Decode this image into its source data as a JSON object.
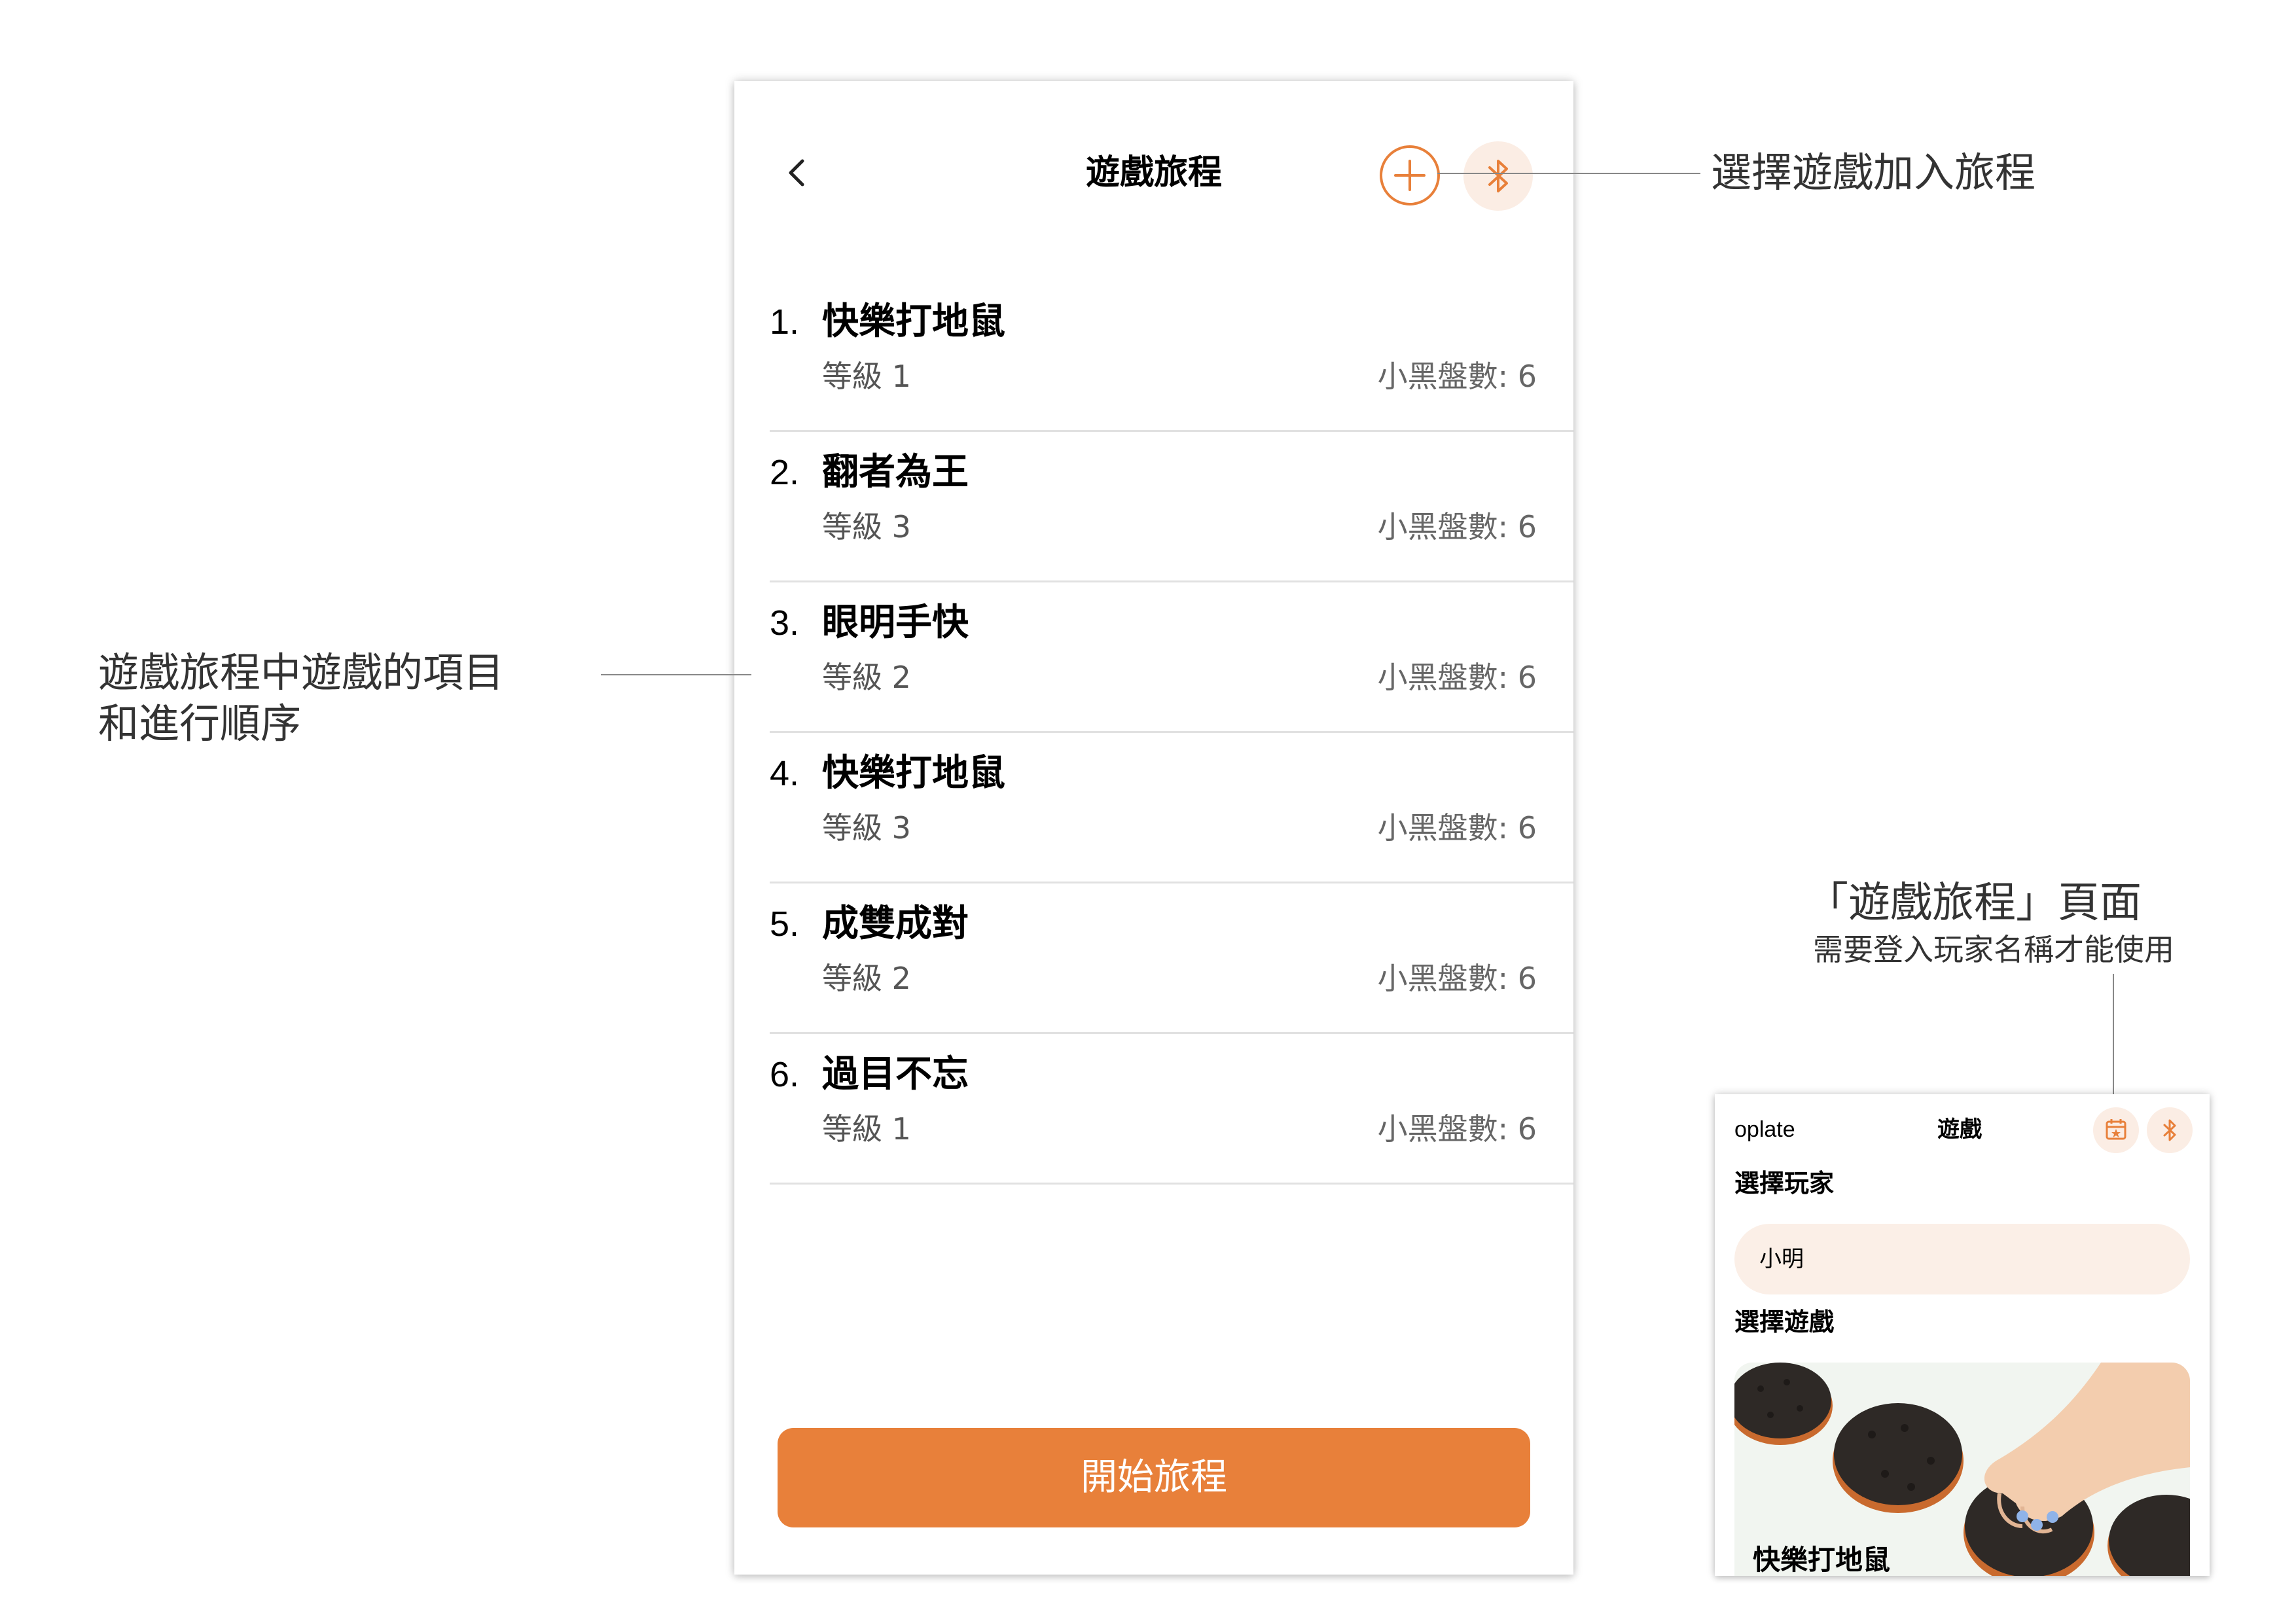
{
  "journey_screen": {
    "back_icon": "chevron-left-icon",
    "title": "遊戲旅程",
    "add_icon": "plus-circle-icon",
    "bluetooth_icon": "bluetooth-icon",
    "items": [
      {
        "number": "1.",
        "name": "快樂打地鼠",
        "level": "等級 1",
        "chips": "小黑盤數: 6"
      },
      {
        "number": "2.",
        "name": "翻者為王",
        "level": "等級 3",
        "chips": "小黑盤數: 6"
      },
      {
        "number": "3.",
        "name": "眼明手快",
        "level": "等級 2",
        "chips": "小黑盤數: 6"
      },
      {
        "number": "4.",
        "name": "快樂打地鼠",
        "level": "等級 3",
        "chips": "小黑盤數: 6"
      },
      {
        "number": "5.",
        "name": "成雙成對",
        "level": "等級 2",
        "chips": "小黑盤數: 6"
      },
      {
        "number": "6.",
        "name": "過目不忘",
        "level": "等級 1",
        "chips": "小黑盤數: 6"
      }
    ],
    "start_button": "開始旅程"
  },
  "annotations": {
    "add_game": "選擇遊戲加入旅程",
    "items_order_line1": "遊戲旅程中遊戲的項目",
    "items_order_line2": "和進行順序",
    "page_title": "「遊戲旅程」頁面",
    "page_subtitle": "需要登入玩家名稱才能使用"
  },
  "mini_screen": {
    "app_name": "oplate",
    "title": "遊戲",
    "calendar_icon": "calendar-star-icon",
    "bluetooth_icon": "bluetooth-icon",
    "select_player_label": "選擇玩家",
    "player_value": "小明",
    "select_game_label": "選擇遊戲",
    "game_card_title": "快樂打地鼠"
  },
  "colors": {
    "accent": "#E8803A",
    "accent_light": "#FBEDE4",
    "divider": "#E1E1E1"
  }
}
